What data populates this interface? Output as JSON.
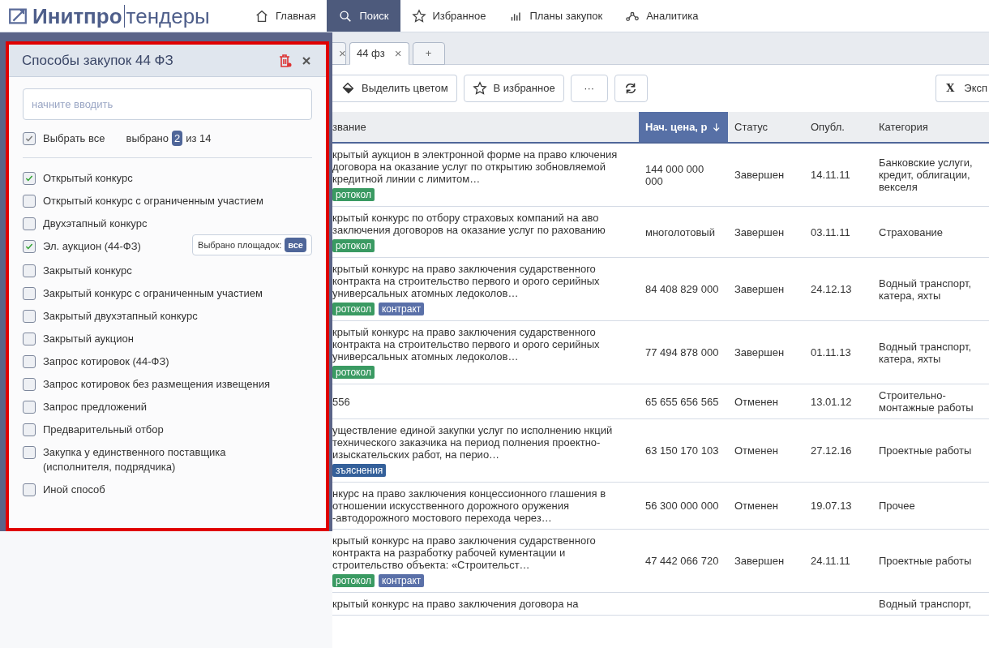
{
  "logo": {
    "brand": "Инитпро",
    "product": "тендеры"
  },
  "nav": [
    {
      "label": "Главная",
      "selected": false
    },
    {
      "label": "Поиск",
      "selected": true
    },
    {
      "label": "Избранное",
      "selected": false
    },
    {
      "label": "Планы закупок",
      "selected": false
    },
    {
      "label": "Аналитика",
      "selected": false
    }
  ],
  "filter_panel": {
    "title": "Способы закупок 44 ФЗ",
    "search": {
      "placeholder": "начните вводить"
    },
    "select_all": {
      "label": "Выбрать все",
      "checked": true
    },
    "selected_count": {
      "prefix": "выбрано",
      "count": "2",
      "suffix": "из 14"
    },
    "options": [
      {
        "label": "Открытый конкурс",
        "checked": true
      },
      {
        "label": "Открытый конкурс с ограниченным участием",
        "checked": false
      },
      {
        "label": "Двухэтапный конкурс",
        "checked": false
      },
      {
        "label": "Эл. аукцион (44-ФЗ)",
        "checked": true,
        "platforms": {
          "label": "Выбрано площадок:",
          "value": "все"
        }
      },
      {
        "label": "Закрытый конкурс",
        "checked": false
      },
      {
        "label": "Закрытый конкурс с ограниченным участием",
        "checked": false
      },
      {
        "label": "Закрытый двухэтапный конкурс",
        "checked": false
      },
      {
        "label": "Закрытый аукцион",
        "checked": false
      },
      {
        "label": "Запрос котировок (44-ФЗ)",
        "checked": false
      },
      {
        "label": "Запрос котировок без размещения извещения",
        "checked": false
      },
      {
        "label": "Запрос предложений",
        "checked": false
      },
      {
        "label": "Предварительный отбор",
        "checked": false
      },
      {
        "label": "Закупка у единственного поставщика (исполнителя, подрядчика)",
        "checked": false
      },
      {
        "label": "Иной способ",
        "checked": false
      }
    ]
  },
  "tabs": [
    {
      "close": "×",
      "selected": false
    },
    {
      "label": "44 фз",
      "close": "×",
      "selected": true
    },
    {
      "label": "+",
      "selected": false
    }
  ],
  "toolbar": [
    {
      "label": "Выделить цветом"
    },
    {
      "label": "В избранное"
    },
    {
      "label": "···"
    }
  ],
  "export_button": {
    "label": "Эксп",
    "icon": "X"
  },
  "table": {
    "columns": [
      {
        "label": "звание",
        "sorted": false
      },
      {
        "label": "Нач. цена, р",
        "sorted": true
      },
      {
        "label": "Статус",
        "sorted": false
      },
      {
        "label": "Опубл.",
        "sorted": false
      },
      {
        "label": "Категория",
        "sorted": false
      }
    ],
    "rows": [
      {
        "title": "крытый аукцион в электронной форме на право ключения договора на оказание услуг по открытию зобновляемой кредитной линии с лимитом…",
        "tags": [
          {
            "label": "ротокол",
            "color": "#3a9a62"
          }
        ],
        "price": "144 000 000 000",
        "status": "Завершен",
        "date": "14.11.11",
        "category": "Банковские услуги, кредит, облигации, векселя"
      },
      {
        "title": "крытый конкурс по отбору страховых компаний на аво заключения договоров на оказание услуг по рахованию",
        "tags": [
          {
            "label": "ротокол",
            "color": "#3a9a62"
          }
        ],
        "price": "многолотовый",
        "status": "Завершен",
        "date": "03.11.11",
        "category": "Страхование"
      },
      {
        "title": "крытый конкурс на право заключения сударственного контракта на строительство первого и орого серийных универсальных атомных ледоколов…",
        "tags": [
          {
            "label": "ротокол",
            "color": "#3a9a62"
          },
          {
            "label": "контракт",
            "color": "#5a70a8"
          }
        ],
        "price": "84 408 829 000",
        "status": "Завершен",
        "date": "24.12.13",
        "category": "Водный транспорт, катера, яхты"
      },
      {
        "title": "крытый конкурс на право заключения сударственного контракта на строительство первого и орого серийных универсальных атомных ледоколов…",
        "tags": [
          {
            "label": "ротокол",
            "color": "#3a9a62"
          }
        ],
        "price": "77 494 878 000",
        "status": "Завершен",
        "date": "01.11.13",
        "category": "Водный транспорт, катера, яхты"
      },
      {
        "title": "556",
        "tags": [],
        "price": "65 655 656 565",
        "status": "Отменен",
        "date": "13.01.12",
        "category": "Строительно-монтажные работы"
      },
      {
        "title": "уществление единой закупки услуг по исполнению нкций технического заказчика на период полнения проектно-изыскательских работ, на перио…",
        "tags": [
          {
            "label": "зъяснения",
            "color": "#34609a"
          }
        ],
        "price": "63 150 170 103",
        "status": "Отменен",
        "date": "27.12.16",
        "category": "Проектные работы"
      },
      {
        "title": "нкурс на право заключения концессионного глашения в отношении искусственного дорожного оружения -автодорожного мостового перехода через…",
        "tags": [],
        "price": "56 300 000 000",
        "status": "Отменен",
        "date": "19.07.13",
        "category": "Прочее"
      },
      {
        "title": "крытый конкурс на право заключения сударственного контракта на разработку рабочей кументации и строительство объекта: «Строительст…",
        "tags": [
          {
            "label": "ротокол",
            "color": "#3a9a62"
          },
          {
            "label": "контракт",
            "color": "#5a70a8"
          }
        ],
        "price": "47 442 066 720",
        "status": "Завершен",
        "date": "24.11.11",
        "category": "Проектные работы"
      },
      {
        "title": "крытый конкурс на право заключения договора на",
        "tags": [],
        "price": "",
        "status": "",
        "date": "",
        "category": "Водный транспорт,"
      }
    ]
  }
}
